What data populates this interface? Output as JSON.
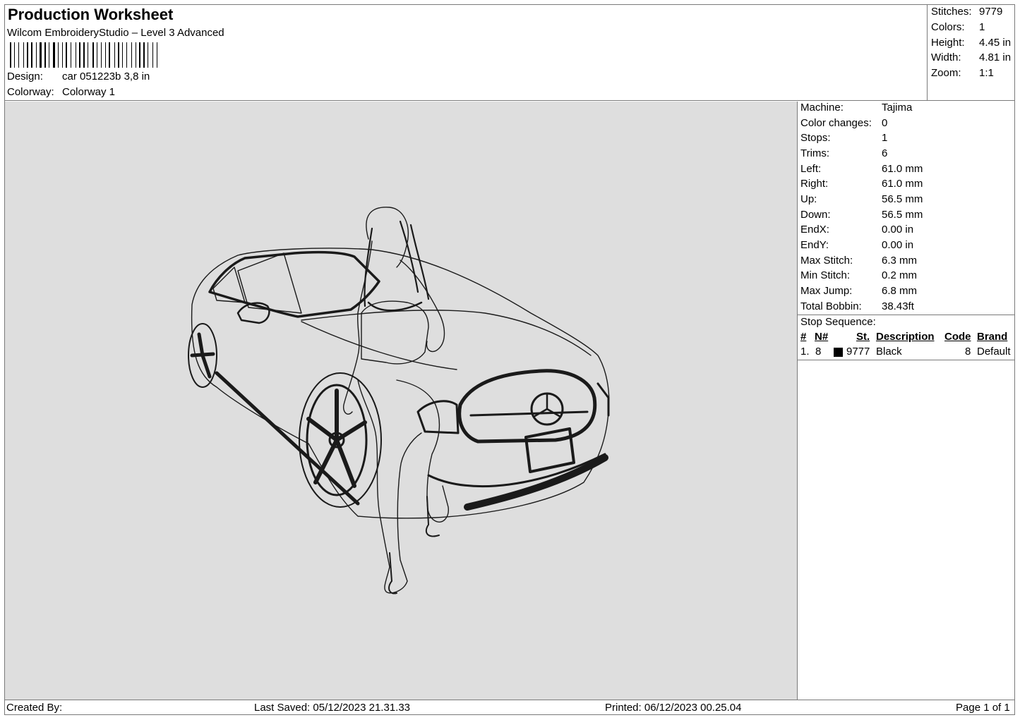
{
  "header": {
    "title": "Production Worksheet",
    "software": "Wilcom EmbroideryStudio – Level 3 Advanced",
    "design_label": "Design:",
    "design_value": "car 051223b 3,8 in",
    "colorway_label": "Colorway:",
    "colorway_value": "Colorway 1"
  },
  "stats": [
    {
      "label": "Stitches:",
      "value": "9779"
    },
    {
      "label": "Colors:",
      "value": "1"
    },
    {
      "label": "Height:",
      "value": "4.45 in"
    },
    {
      "label": "Width:",
      "value": "4.81 in"
    },
    {
      "label": "Zoom:",
      "value": "1:1"
    }
  ],
  "details": [
    {
      "label": "Machine:",
      "value": "Tajima"
    },
    {
      "label": "Color changes:",
      "value": "0"
    },
    {
      "label": "Stops:",
      "value": "1"
    },
    {
      "label": "Trims:",
      "value": "6"
    },
    {
      "label": "Left:",
      "value": "61.0 mm"
    },
    {
      "label": "Right:",
      "value": "61.0 mm"
    },
    {
      "label": "Up:",
      "value": "56.5 mm"
    },
    {
      "label": "Down:",
      "value": "56.5 mm"
    },
    {
      "label": "EndX:",
      "value": "0.00 in"
    },
    {
      "label": "EndY:",
      "value": "0.00 in"
    },
    {
      "label": "Max Stitch:",
      "value": "6.3 mm"
    },
    {
      "label": "Min Stitch:",
      "value": "0.2 mm"
    },
    {
      "label": "Max Jump:",
      "value": "6.8 mm"
    },
    {
      "label": "Total Bobbin:",
      "value": "38.43ft"
    }
  ],
  "stop_sequence": {
    "title": "Stop Sequence:",
    "columns": [
      "#",
      "N#",
      "St.",
      "Description",
      "Code",
      "Brand"
    ],
    "rows": [
      {
        "num": "1.",
        "needle": "8",
        "swatch_color": "#000000",
        "stitches": "9777",
        "description": "Black",
        "code": "8",
        "brand": "Default"
      }
    ]
  },
  "footer": {
    "created_by": "Created By:",
    "last_saved": "Last Saved: 05/12/2023 21.31.33",
    "printed": "Printed: 06/12/2023 00.25.04",
    "page": "Page 1 of 1"
  },
  "colors": {
    "canvas_bg": "#dedede",
    "thread": "#1a1a1a"
  }
}
